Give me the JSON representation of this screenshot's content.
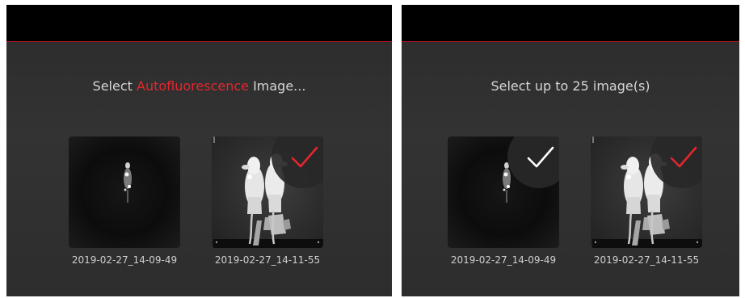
{
  "left_panel": {
    "prompt": {
      "prefix": "Select ",
      "highlight": "Autofluorescence",
      "suffix": " Image..."
    },
    "images": [
      {
        "timestamp": "2019-02-27_14-09-49",
        "selected": false
      },
      {
        "timestamp": "2019-02-27_14-11-55",
        "selected": true,
        "check_color": "#e3262e"
      }
    ]
  },
  "right_panel": {
    "prompt": "Select up to 25 image(s)",
    "images": [
      {
        "timestamp": "2019-02-27_14-09-49",
        "selected": true,
        "check_color": "#ffffff"
      },
      {
        "timestamp": "2019-02-27_14-11-55",
        "selected": true,
        "check_color": "#e3262e"
      }
    ]
  },
  "colors": {
    "accent": "#e3262e",
    "background": "#2f2f2f",
    "topbar": "#000000",
    "text": "#d6d6d6"
  },
  "icons": [
    "checkmark-icon"
  ]
}
